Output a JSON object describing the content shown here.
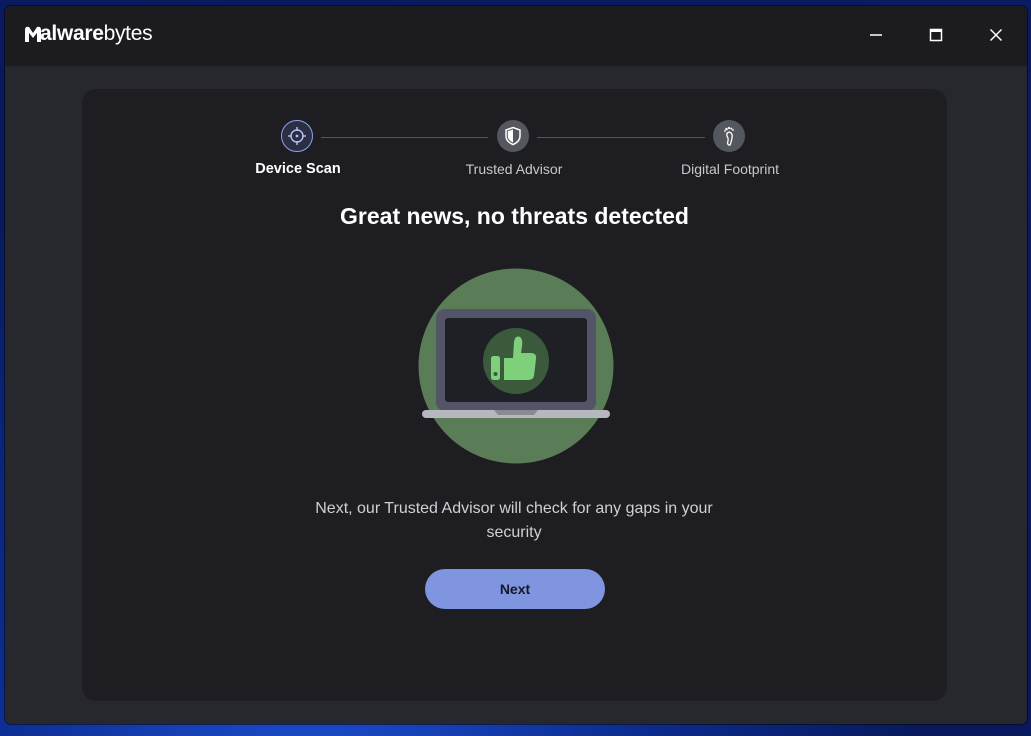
{
  "app": {
    "logo_bold": "Malware",
    "logo_regular": "bytes",
    "logo_full": "Malwarebytes"
  },
  "window_controls": {
    "minimize_icon": "minimize-icon",
    "maximize_icon": "maximize-icon",
    "close_icon": "close-icon"
  },
  "stepper": {
    "steps": [
      {
        "label": "Device Scan",
        "icon": "crosshair-icon",
        "active": true
      },
      {
        "label": "Trusted Advisor",
        "icon": "shield-icon",
        "active": false
      },
      {
        "label": "Digital Footprint",
        "icon": "footprint-icon",
        "active": false
      }
    ]
  },
  "main": {
    "headline": "Great news, no threats detected",
    "illustration_icon": "laptop-thumbs-up-icon",
    "body": "Next, our Trusted Advisor will check for any gaps in your security",
    "next_button": "Next"
  },
  "colors": {
    "accent": "#7f95e0",
    "success_circle": "#5a7c57",
    "thumb": "#7ed07a",
    "background": "#1e1e22"
  }
}
